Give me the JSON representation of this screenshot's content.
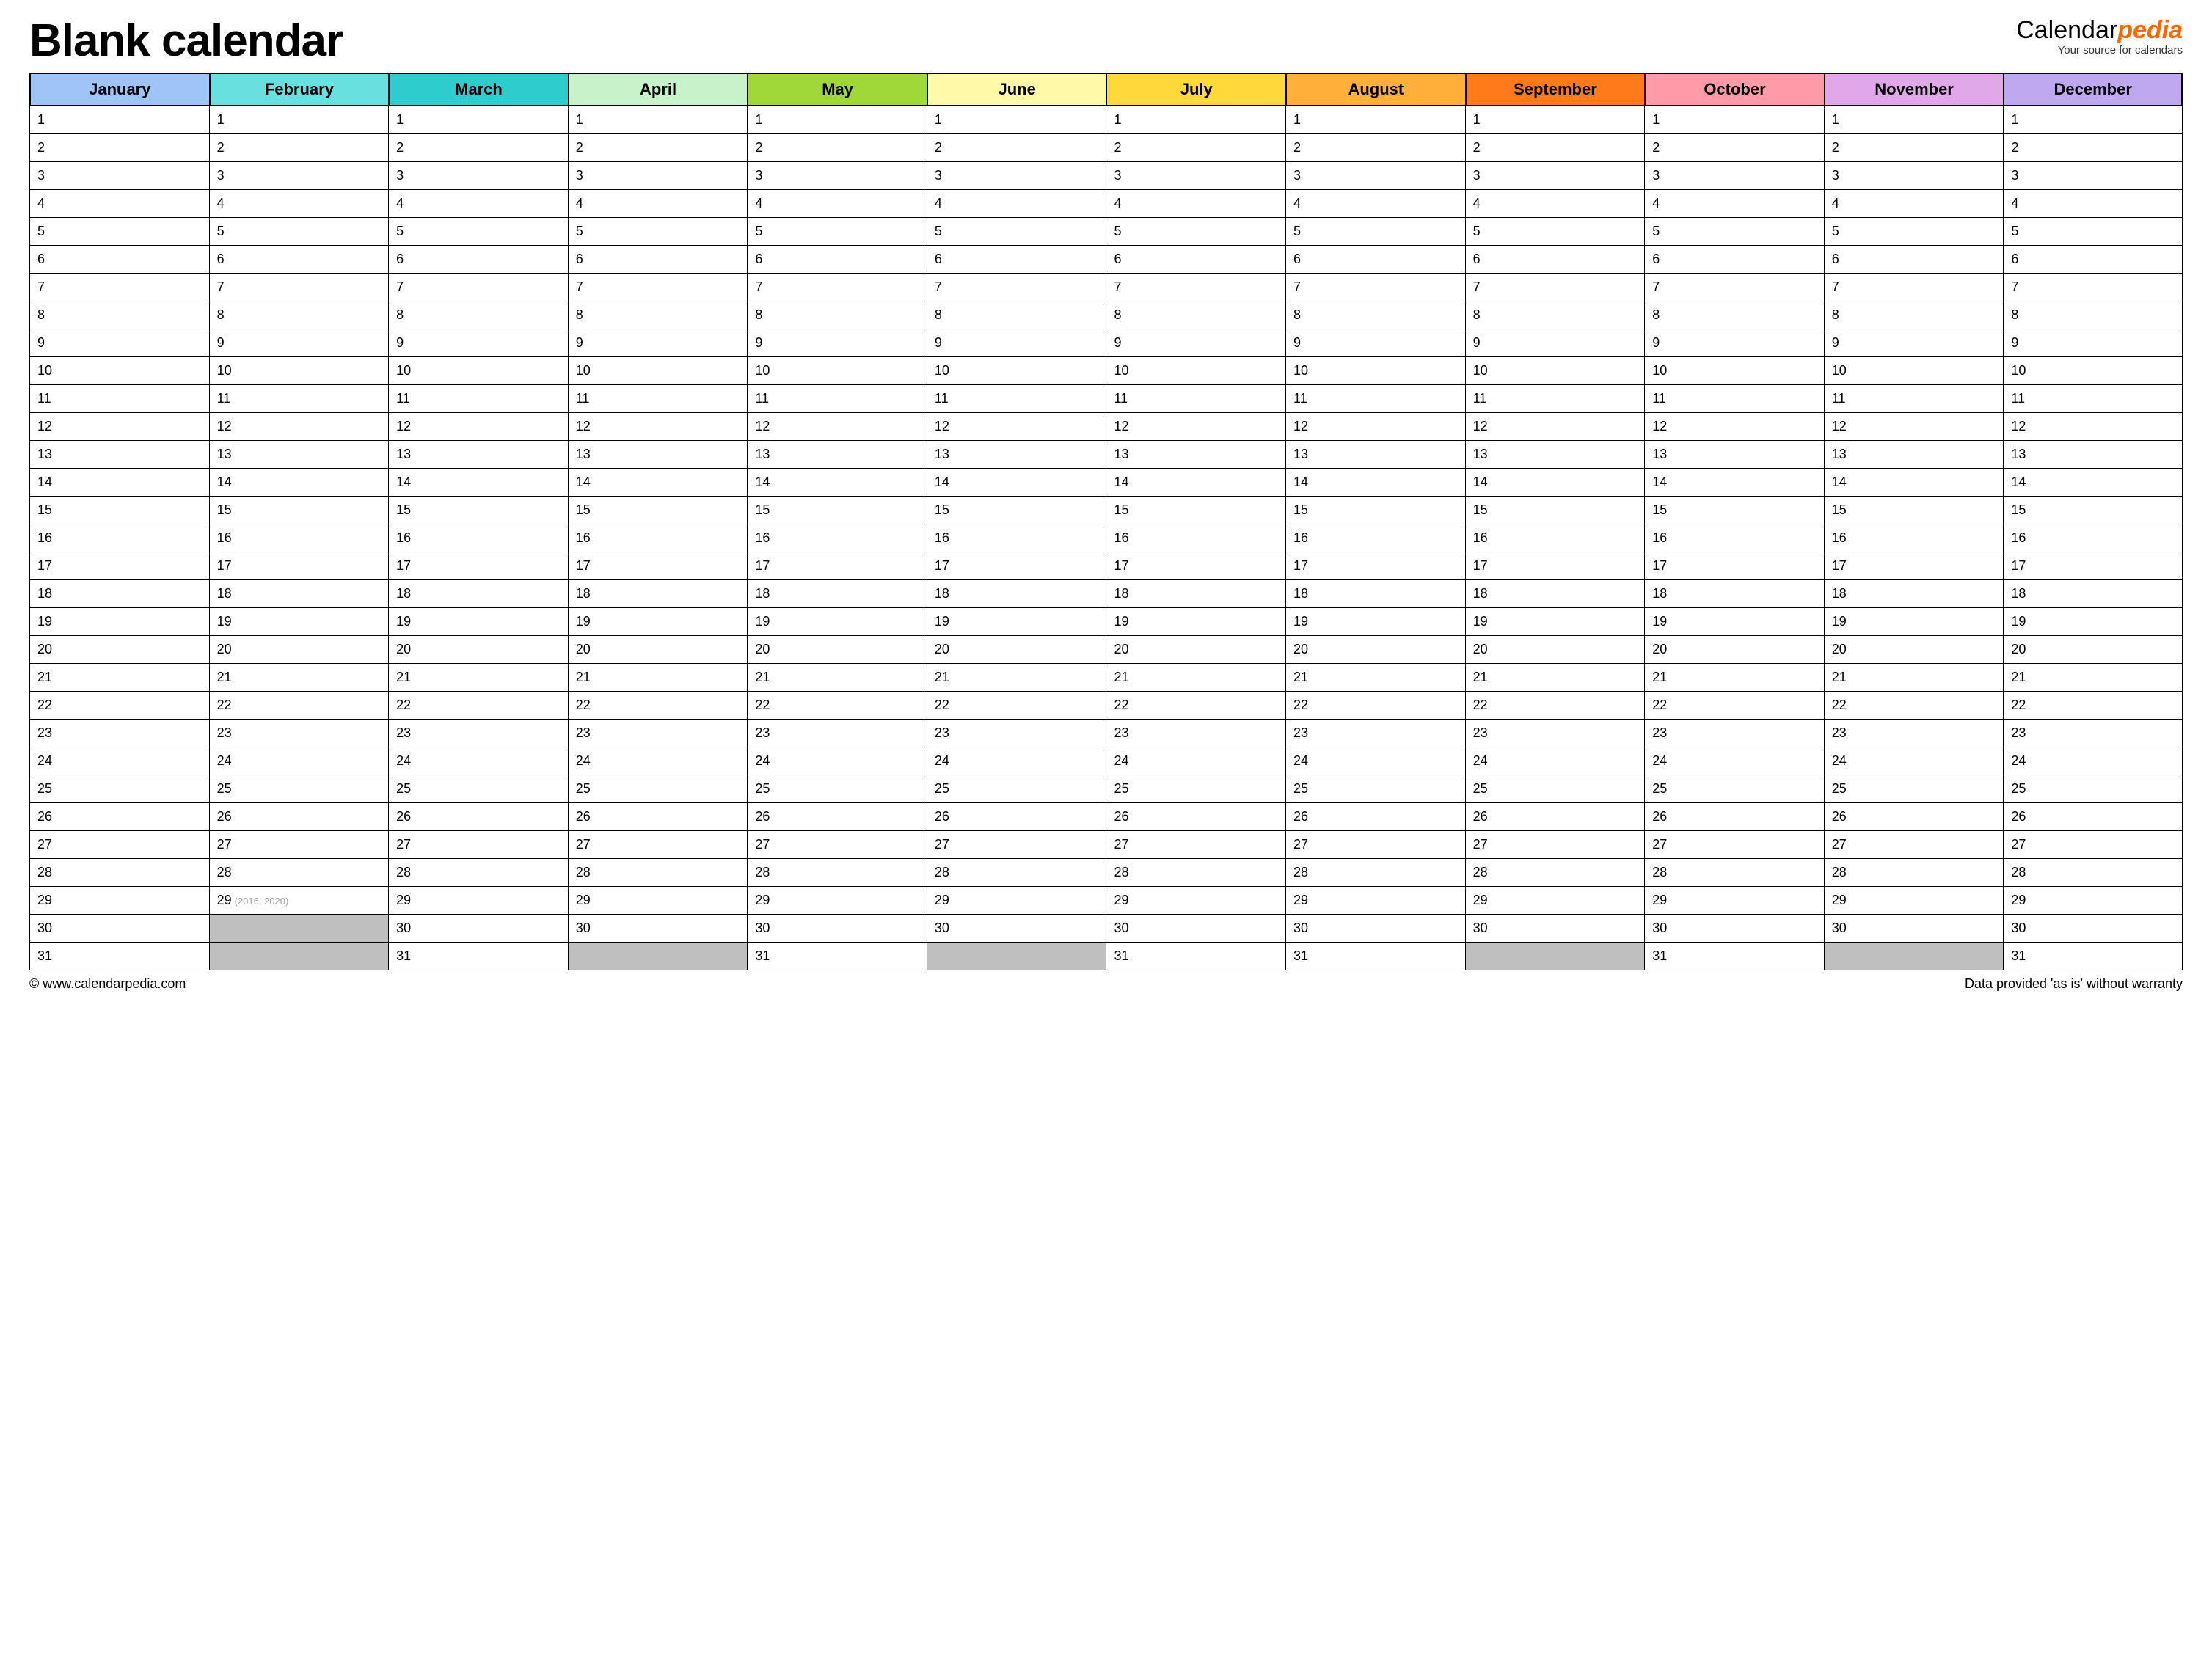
{
  "header": {
    "title": "Blank calendar",
    "brand_prefix": "Calendar",
    "brand_accent": "pedia",
    "brand_sub": "Your source for calendars"
  },
  "months": [
    {
      "name": "January",
      "color": "#9fc5f8",
      "days": 31
    },
    {
      "name": "February",
      "color": "#68e0e0",
      "days": 29
    },
    {
      "name": "March",
      "color": "#2ecccc",
      "days": 31
    },
    {
      "name": "April",
      "color": "#c8f2c9",
      "days": 30
    },
    {
      "name": "May",
      "color": "#a0d83a",
      "days": 31
    },
    {
      "name": "June",
      "color": "#fff9a8",
      "days": 30
    },
    {
      "name": "July",
      "color": "#ffd83a",
      "days": 31
    },
    {
      "name": "August",
      "color": "#ffb03a",
      "days": 31
    },
    {
      "name": "September",
      "color": "#ff7a1a",
      "days": 30
    },
    {
      "name": "October",
      "color": "#ff9aa8",
      "days": 31
    },
    {
      "name": "November",
      "color": "#e0a8e8",
      "days": 30
    },
    {
      "name": "December",
      "color": "#c0a8f0",
      "days": 31
    }
  ],
  "max_rows": 31,
  "leap_cell": {
    "month_index": 1,
    "day": 29,
    "note": "(2016, 2020)"
  },
  "footer": {
    "left": "© www.calendarpedia.com",
    "right": "Data provided 'as is' without warranty"
  }
}
